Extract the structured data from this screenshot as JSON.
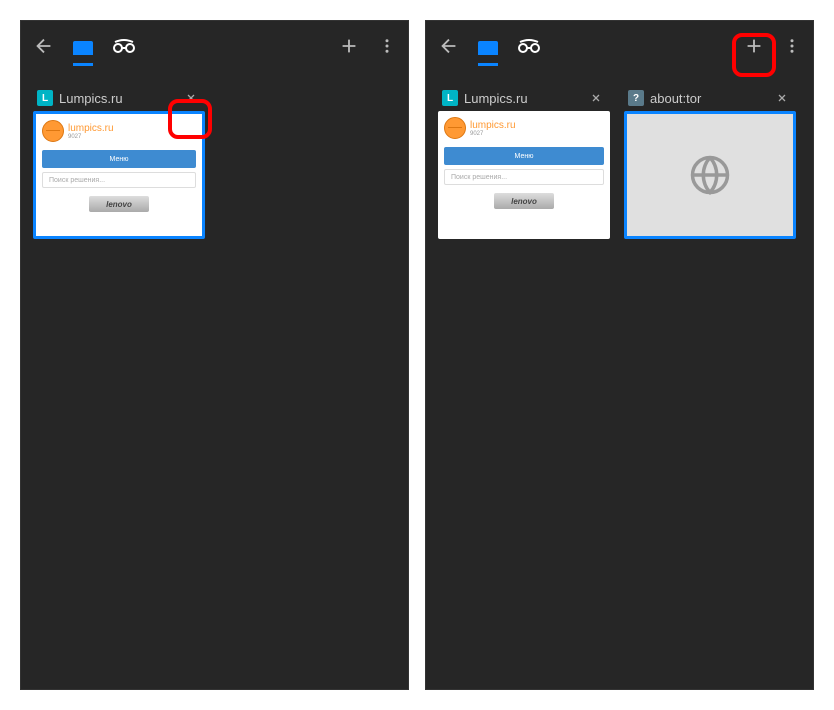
{
  "screens": {
    "left": {
      "tabs": [
        {
          "favicon_letter": "L",
          "title": "Lumpics.ru"
        }
      ],
      "thumb": {
        "brand": "lumpics.ru",
        "sub": "9027",
        "button": "Меню",
        "search": "Поиск решения..."
      }
    },
    "right": {
      "tabs": [
        {
          "favicon_letter": "L",
          "title": "Lumpics.ru"
        },
        {
          "favicon_letter": "?",
          "title": "about:tor"
        }
      ],
      "thumb": {
        "brand": "lumpics.ru",
        "sub": "9027",
        "button": "Меню",
        "search": "Поиск решения..."
      }
    }
  }
}
